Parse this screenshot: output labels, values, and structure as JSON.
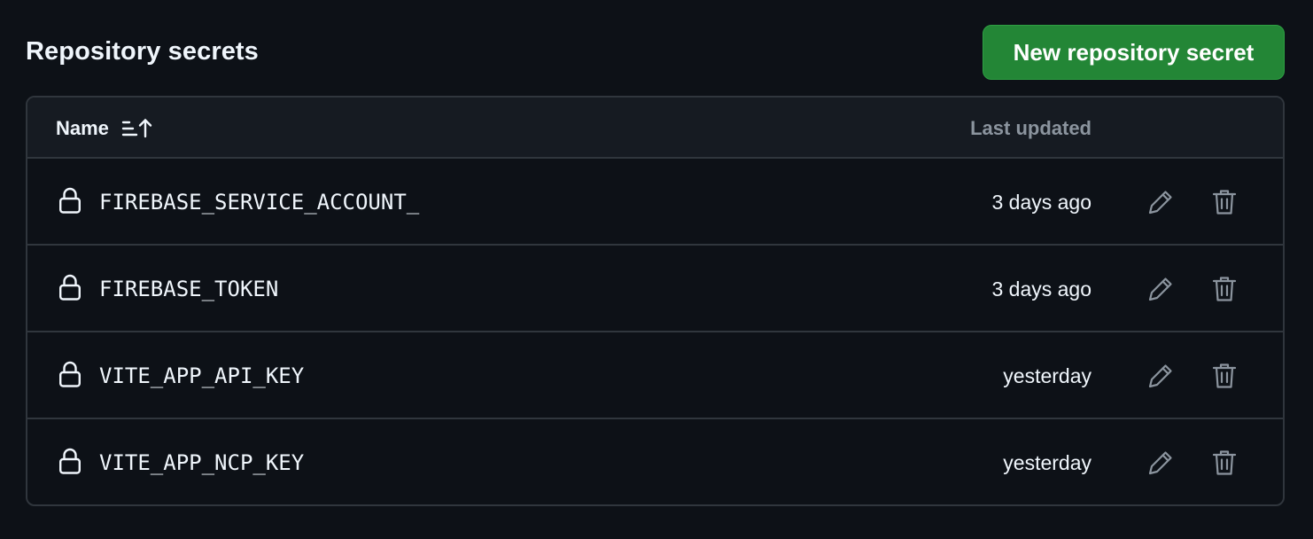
{
  "section": {
    "title": "Repository secrets",
    "new_button_label": "New repository secret"
  },
  "table": {
    "columns": {
      "name": "Name",
      "last_updated": "Last updated"
    },
    "rows": [
      {
        "name": "FIREBASE_SERVICE_ACCOUNT_",
        "updated": "3 days ago"
      },
      {
        "name": "FIREBASE_TOKEN",
        "updated": "3 days ago"
      },
      {
        "name": "VITE_APP_API_KEY",
        "updated": "yesterday"
      },
      {
        "name": "VITE_APP_NCP_KEY",
        "updated": "yesterday"
      }
    ]
  },
  "icons": {
    "sort": "sort-ascending-icon",
    "lock": "lock-icon",
    "edit": "pencil-icon",
    "delete": "trash-icon"
  },
  "colors": {
    "background": "#0d1117",
    "header_background": "#161b22",
    "border": "#30363d",
    "primary_button": "#238636",
    "muted_text": "#8b949e",
    "text": "#f0f6fc"
  }
}
